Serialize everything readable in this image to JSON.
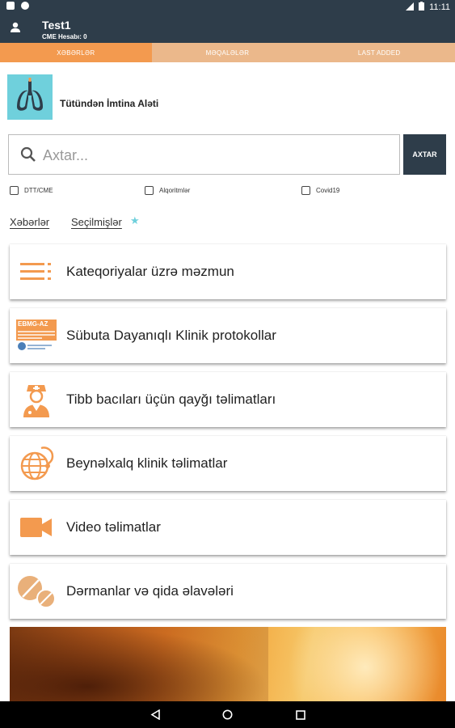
{
  "status_bar": {
    "time": "11:11"
  },
  "header": {
    "title": "Test1",
    "subtitle": "CME Hesabı: 0"
  },
  "tabs": [
    {
      "label": "XƏBƏRLƏR",
      "active": true
    },
    {
      "label": "MƏQALƏLƏR",
      "active": false
    },
    {
      "label": "LAST ADDED",
      "active": false
    }
  ],
  "brand": {
    "title": "Tütündən İmtina Aləti"
  },
  "search": {
    "placeholder": "Axtar...",
    "button": "AXTAR"
  },
  "filters": [
    {
      "label": "DTT/CME",
      "checked": false
    },
    {
      "label": "Alqoritmlər",
      "checked": false
    },
    {
      "label": "Covid19",
      "checked": false
    }
  ],
  "links": {
    "news": "Xəbərlər",
    "favorites": "Seçilmişlər"
  },
  "menu": [
    {
      "label": "Kateqoriyalar üzrə məzmun",
      "icon": "list-icon"
    },
    {
      "label": "Sübuta Dayanıqlı Klinik protokollar",
      "icon": "ebmg-logo",
      "icon_text": "EBMG-AZ"
    },
    {
      "label": "Tibb bacıları üçün qayğı təlimatları",
      "icon": "nurse-icon"
    },
    {
      "label": "Beynəlxalq klinik təlimatlar",
      "icon": "globe-stethoscope-icon"
    },
    {
      "label": "Video təlimatlar",
      "icon": "video-camera-icon"
    },
    {
      "label": "Dərmanlar və qida əlavələri",
      "icon": "pills-icon"
    }
  ],
  "colors": {
    "primary": "#2e3d4a",
    "accent": "#f39a4f",
    "accent_light": "#ebb88b",
    "brand": "#6fd0dc"
  }
}
